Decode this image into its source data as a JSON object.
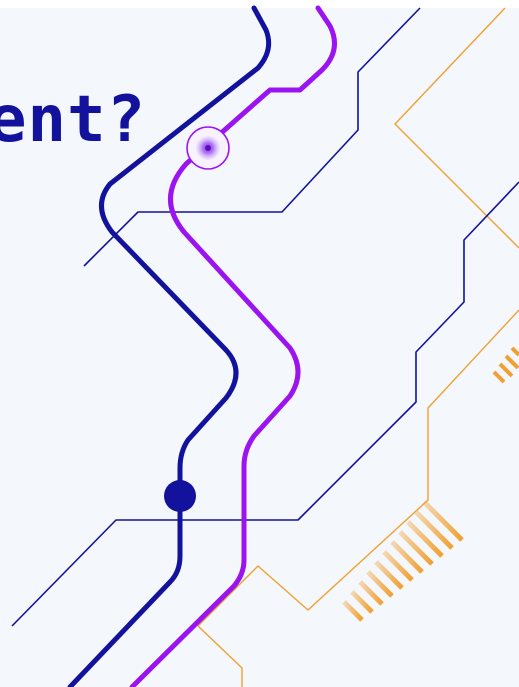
{
  "headline": {
    "text": "ent?"
  },
  "colors": {
    "background": "#F4F7FC",
    "navy": "#12129C",
    "purple": "#9B14F0",
    "orange": "#F0A030"
  }
}
